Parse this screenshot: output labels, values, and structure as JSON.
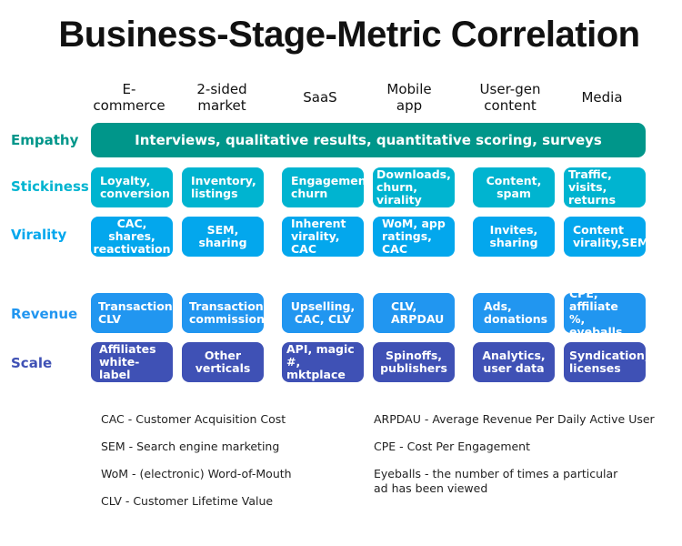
{
  "title": "Business-Stage-Metric Correlation",
  "columns": [
    "E-\ncommerce",
    "2-sided\nmarket",
    "SaaS",
    "Mobile\napp",
    "User-gen\ncontent",
    "Media"
  ],
  "colors": {
    "empathy": "#00968a",
    "stickiness": "#00b4d0",
    "virality": "#03a7ed",
    "revenue": "#2196f0",
    "scale": "#3f51b5"
  },
  "rows": {
    "empathy": {
      "label": "Empathy",
      "span_text": "Interviews, qualitative results, quantitative scoring, surveys"
    },
    "stickiness": {
      "label": "Stickiness",
      "cells": [
        "Loyalty,\nconversion",
        "Inventory,\nlistings",
        "Engagement,\nchurn",
        "Downloads,\nchurn, virality",
        "Content,\nspam",
        "Traffic, visits,\nreturns"
      ]
    },
    "virality": {
      "label": "Virality",
      "cells": [
        "CAC, shares,\nreactivation",
        "SEM, sharing",
        "Inherent\nvirality, CAC",
        "WoM, app\nratings, CAC",
        "Invites,\nsharing",
        "Content\nvirality,SEM"
      ]
    },
    "revenue": {
      "label": "Revenue",
      "cells": [
        "Transaction,\nCLV",
        "Transaction,\ncommission",
        "Upselling,\nCAC, CLV",
        "CLV,\nARPDAU",
        "Ads,\ndonations",
        "CPE, affiliate\n%, eyeballs"
      ]
    },
    "scale": {
      "label": "Scale",
      "cells": [
        "Affiliates\nwhite-label",
        "Other\nverticals",
        "API, magic #,\nmktplace",
        "Spinoffs,\npublishers",
        "Analytics,\nuser data",
        "Syndication,\nlicenses"
      ]
    }
  },
  "glossary_left": [
    "CAC - Customer Acquisition Cost",
    "SEM - Search engine marketing",
    "WoM - (electronic) Word-of-Mouth",
    "CLV - Customer Lifetime Value"
  ],
  "glossary_right": [
    "ARPDAU - Average Revenue Per Daily Active User",
    "CPE - Cost Per Engagement",
    "Eyeballs - the number of times a particular\nad has been viewed"
  ]
}
